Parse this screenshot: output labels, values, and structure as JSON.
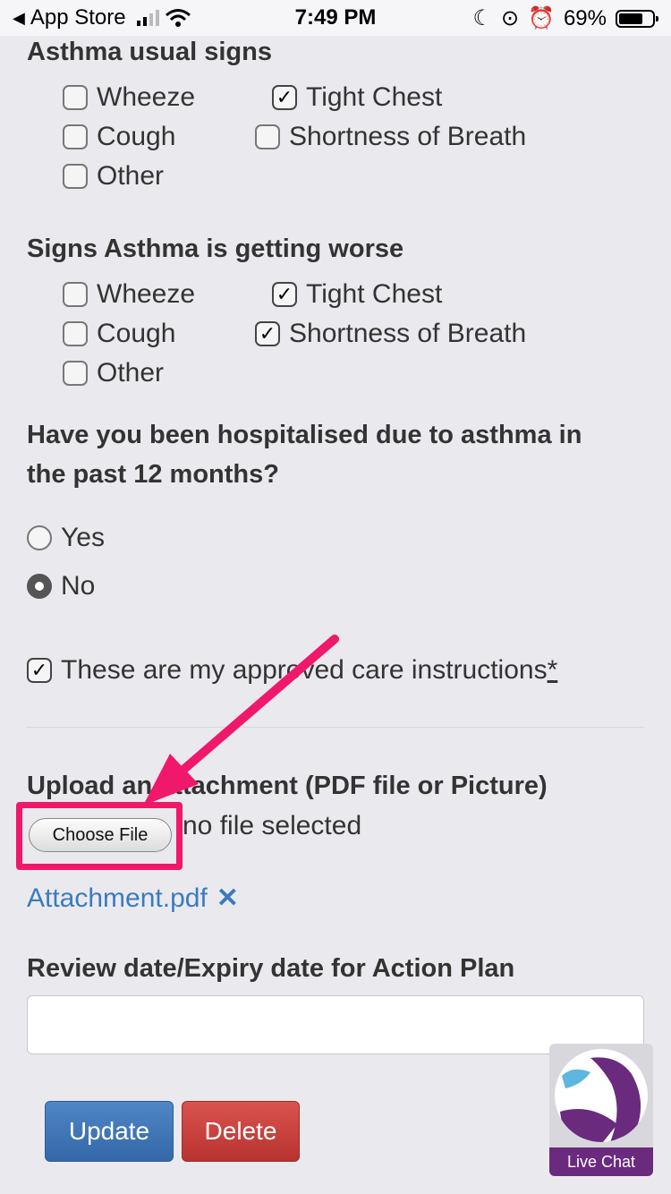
{
  "status_bar": {
    "back_app": "App Store",
    "time": "7:49 PM",
    "battery_percent": "69%"
  },
  "sections": {
    "usual_signs": {
      "heading": "Asthma usual signs",
      "options": [
        {
          "label": "Wheeze",
          "checked": false
        },
        {
          "label": "Tight Chest",
          "checked": true
        },
        {
          "label": "Cough",
          "checked": false
        },
        {
          "label": "Shortness of Breath",
          "checked": false
        },
        {
          "label": "Other",
          "checked": false
        }
      ]
    },
    "worse_signs": {
      "heading": "Signs Asthma is getting worse",
      "options": [
        {
          "label": "Wheeze",
          "checked": false
        },
        {
          "label": "Tight Chest",
          "checked": true
        },
        {
          "label": "Cough",
          "checked": false
        },
        {
          "label": "Shortness of Breath",
          "checked": true
        },
        {
          "label": "Other",
          "checked": false
        }
      ]
    },
    "hospitalised": {
      "heading_line1": "Have you been hospitalised due to asthma in",
      "heading_line2": "the past 12 months?",
      "options": [
        {
          "label": "Yes",
          "selected": false
        },
        {
          "label": "No",
          "selected": true
        }
      ]
    },
    "approved": {
      "label": "These are my approved care instructions",
      "required_mark": "*",
      "checked": true
    },
    "upload": {
      "heading": "Upload an attachment (PDF file or Picture)",
      "choose_label": "Choose File",
      "status": "no file selected",
      "attachment_name": "Attachment.pdf",
      "remove_icon": "✕"
    },
    "review": {
      "heading": "Review date/Expiry date for Action Plan",
      "value": ""
    }
  },
  "actions": {
    "update_label": "Update",
    "delete_label": "Delete"
  },
  "live_chat": {
    "label": "Live Chat"
  },
  "colors": {
    "highlight": "#f0186a",
    "link": "#3a7bbf",
    "update": "#3f78b8",
    "delete": "#c9413d",
    "chat": "#6a2a7e"
  }
}
